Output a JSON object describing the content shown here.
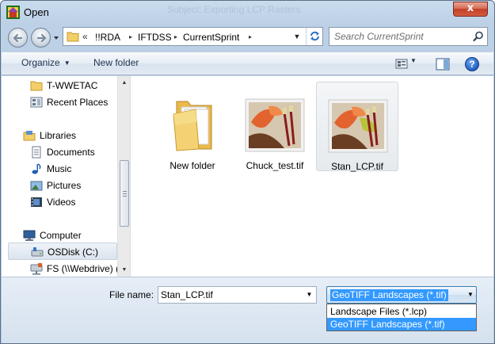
{
  "window": {
    "title": "Open",
    "background_title": "Subject: Exporting LCP Rasters",
    "close_label": "x"
  },
  "address_bar": {
    "overflow": "«",
    "crumbs": [
      "!!RDA",
      "IFTDSS",
      "CurrentSprint"
    ],
    "separator": "▸"
  },
  "search": {
    "placeholder": "Search CurrentSprint"
  },
  "toolbar": {
    "organize_label": "Organize",
    "new_folder_label": "New folder",
    "help_label": "?"
  },
  "nav_pane": {
    "items": [
      {
        "label": "T-WWETAC",
        "icon": "folder-icon",
        "kind": "item"
      },
      {
        "label": "Recent Places",
        "icon": "recent-places-icon",
        "kind": "item"
      },
      {
        "label": "Libraries",
        "icon": "libraries-icon",
        "kind": "header"
      },
      {
        "label": "Documents",
        "icon": "documents-icon",
        "kind": "item"
      },
      {
        "label": "Music",
        "icon": "music-icon",
        "kind": "item"
      },
      {
        "label": "Pictures",
        "icon": "pictures-icon",
        "kind": "item"
      },
      {
        "label": "Videos",
        "icon": "videos-icon",
        "kind": "item"
      },
      {
        "label": "Computer",
        "icon": "computer-icon",
        "kind": "header"
      },
      {
        "label": "OSDisk (C:)",
        "icon": "drive-icon",
        "kind": "item",
        "selected": true
      },
      {
        "label": "FS (\\\\Webdrive) (",
        "icon": "network-drive-icon",
        "kind": "item"
      }
    ]
  },
  "files": [
    {
      "label": "New folder",
      "type": "folder"
    },
    {
      "label": "Chuck_test.tif",
      "type": "image"
    },
    {
      "label": "Stan_LCP.tif",
      "type": "image",
      "selected": true
    }
  ],
  "file_name": {
    "label": "File name:",
    "value": "Stan_LCP.tif"
  },
  "file_type": {
    "selected": "GeoTIFF Landscapes (*.tif)",
    "options": [
      "Landscape Files (*.lcp)",
      "GeoTIFF Landscapes (*.tif)"
    ],
    "highlighted_index": 1
  },
  "colors": {
    "selection_blue": "#3399ff",
    "title_gradient": "#c9dcee",
    "close_red": "#c2402a"
  }
}
